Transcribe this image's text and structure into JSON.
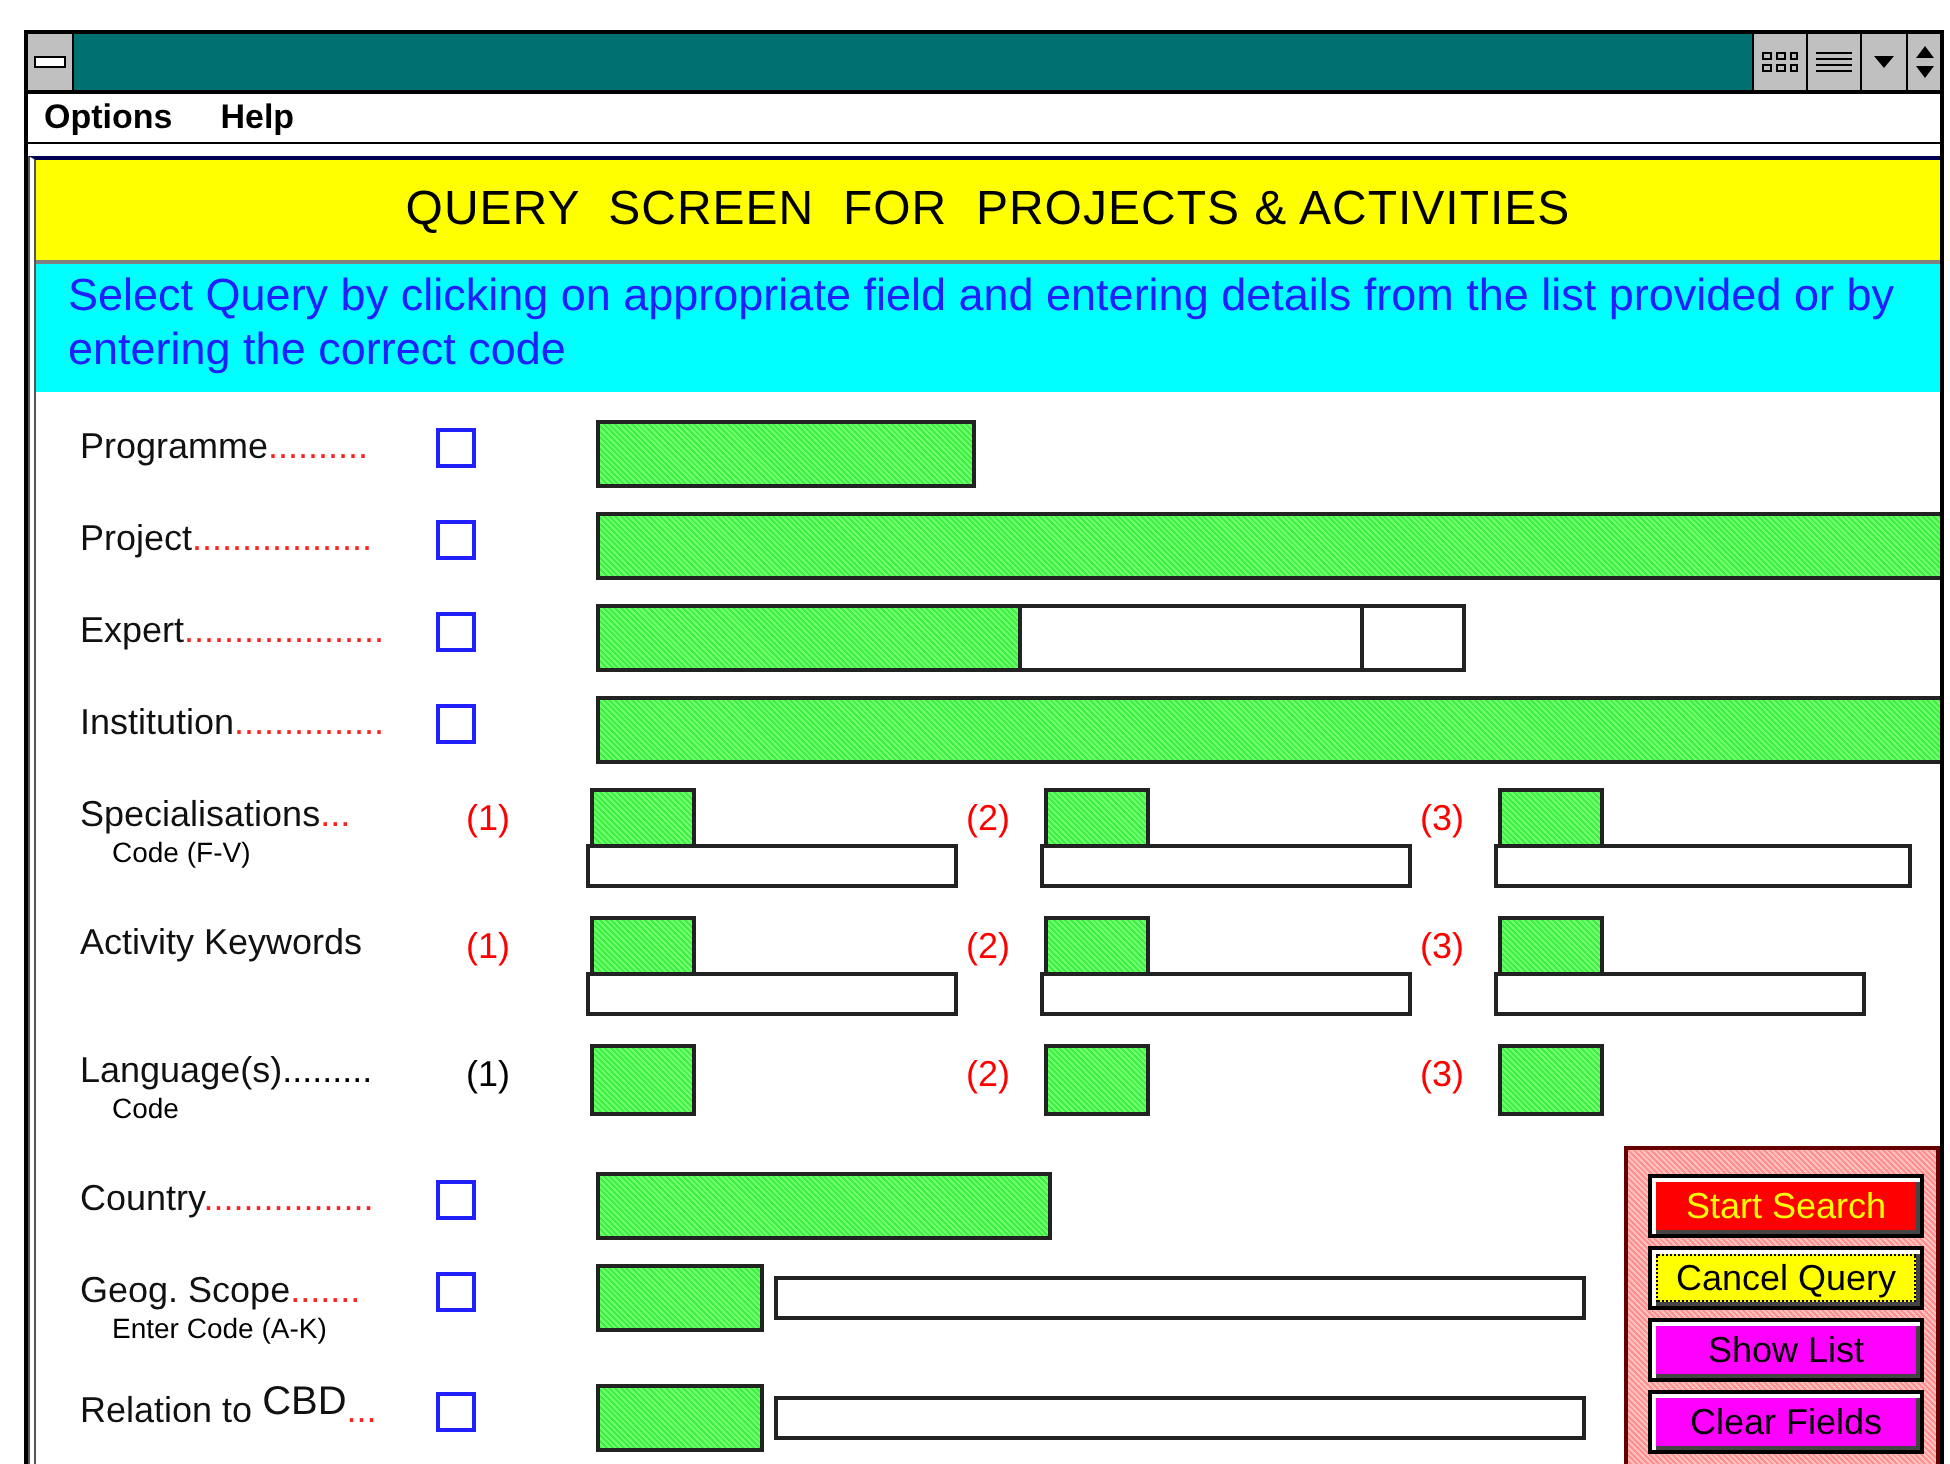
{
  "menu": [
    {
      "label": "Options"
    },
    {
      "label": "Help"
    }
  ],
  "header": {
    "title": "QUERY  SCREEN  FOR  PROJECTS & ACTIVITIES",
    "instructions": "Select Query by clicking on appropriate field and entering details from the list provided or by entering the correct code"
  },
  "rows": [
    {
      "kind": "single",
      "label": "Programme",
      "leader": "..........",
      "checked": false,
      "fields": [
        {
          "kind": "code"
        }
      ]
    },
    {
      "kind": "single",
      "label": "Project",
      "leader": "..................",
      "checked": false,
      "fields": [
        {
          "kind": "code"
        }
      ]
    },
    {
      "kind": "single",
      "label": "Expert",
      "leader": "....................",
      "checked": false,
      "fields": [
        {
          "kind": "code"
        },
        {
          "kind": "text"
        },
        {
          "kind": "text"
        }
      ]
    },
    {
      "kind": "single",
      "label": "Institution",
      "leader": "...............",
      "checked": false,
      "fields": [
        {
          "kind": "code"
        }
      ]
    },
    {
      "kind": "triple",
      "label": "Specialisations",
      "leader": "...",
      "sublabel": "Code (F-V)",
      "groups": [
        {
          "marker": "(1)",
          "color": "#ff0000",
          "text_field": true
        },
        {
          "marker": "(2)",
          "color": "#ff0000",
          "text_field": true
        },
        {
          "marker": "(3)",
          "color": "#ff0000",
          "text_field": true
        }
      ]
    },
    {
      "kind": "triple",
      "label": "Activity Keywords",
      "groups": [
        {
          "marker": "(1)",
          "color": "#ff0000",
          "text_field": true
        },
        {
          "marker": "(2)",
          "color": "#ff0000",
          "text_field": true
        },
        {
          "marker": "(3)",
          "color": "#ff0000",
          "text_field": true
        }
      ]
    },
    {
      "kind": "triple",
      "label": "Language(s)",
      "leader": ".........",
      "color": "#000000",
      "sublabel": "Code",
      "groups": [
        {
          "marker": "(1)",
          "color": "#000000",
          "text_field": false
        },
        {
          "marker": "(2)",
          "color": "#ff0000",
          "text_field": false
        },
        {
          "marker": "(3)",
          "color": "#ff0000",
          "text_field": false
        }
      ]
    },
    {
      "kind": "single",
      "label": "Country",
      "leader": ".................",
      "checked": false,
      "fields": [
        {
          "kind": "code"
        }
      ]
    },
    {
      "kind": "single",
      "label": "Geog. Scope",
      "leader": ".......",
      "sublabel": "Enter Code (A-K)",
      "checked": false,
      "fields": [
        {
          "kind": "code"
        },
        {
          "kind": "text"
        }
      ]
    },
    {
      "kind": "single",
      "label": "Relation to ",
      "label_raised": "CBD",
      "leader": "...",
      "checked": false,
      "fields": [
        {
          "kind": "code"
        },
        {
          "kind": "text"
        }
      ]
    }
  ],
  "buttons": [
    {
      "label": "Start Search",
      "kind": "start"
    },
    {
      "label": "Cancel Query",
      "kind": "cancel"
    },
    {
      "label": "Show List",
      "kind": "list"
    },
    {
      "label": "Clear Fields",
      "kind": "clear"
    }
  ]
}
